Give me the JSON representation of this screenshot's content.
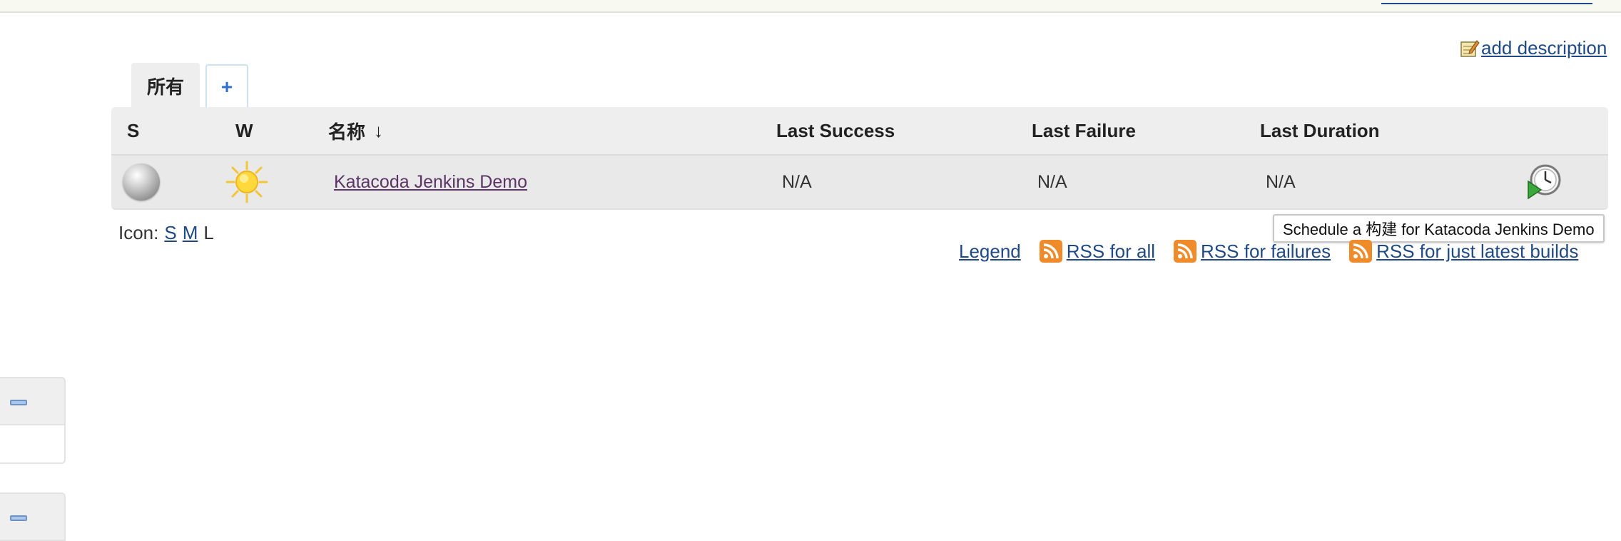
{
  "header": {
    "add_description_label": "add description",
    "notepad_icon": "notepad-icon"
  },
  "tabs": [
    {
      "label": "所有",
      "active": true
    },
    {
      "label": "+",
      "active": false
    }
  ],
  "table": {
    "columns": {
      "status": "S",
      "weather": "W",
      "name": "名称",
      "name_sort": "↓",
      "last_success": "Last Success",
      "last_failure": "Last Failure",
      "last_duration": "Last Duration"
    },
    "rows": [
      {
        "status_icon": "grey-ball-icon",
        "weather_icon": "sun-icon",
        "name": "Katacoda Jenkins Demo",
        "last_success": "N/A",
        "last_failure": "N/A",
        "last_duration": "N/A",
        "action_icon": "schedule-build-icon"
      }
    ]
  },
  "tooltip": {
    "text": "Schedule a 构建 for Katacoda Jenkins Demo"
  },
  "icon_size": {
    "label": "Icon:",
    "options": [
      "S",
      "M",
      "L"
    ],
    "selected": "L"
  },
  "footer_links": {
    "legend": "Legend",
    "rss_all": "RSS for all",
    "rss_failures": "RSS for failures",
    "rss_latest": "RSS for just latest builds"
  },
  "colors": {
    "link": "#204a87",
    "visited_link": "#5c3566",
    "rss": "#f08b2b",
    "table_bg": "#eeeeee"
  }
}
